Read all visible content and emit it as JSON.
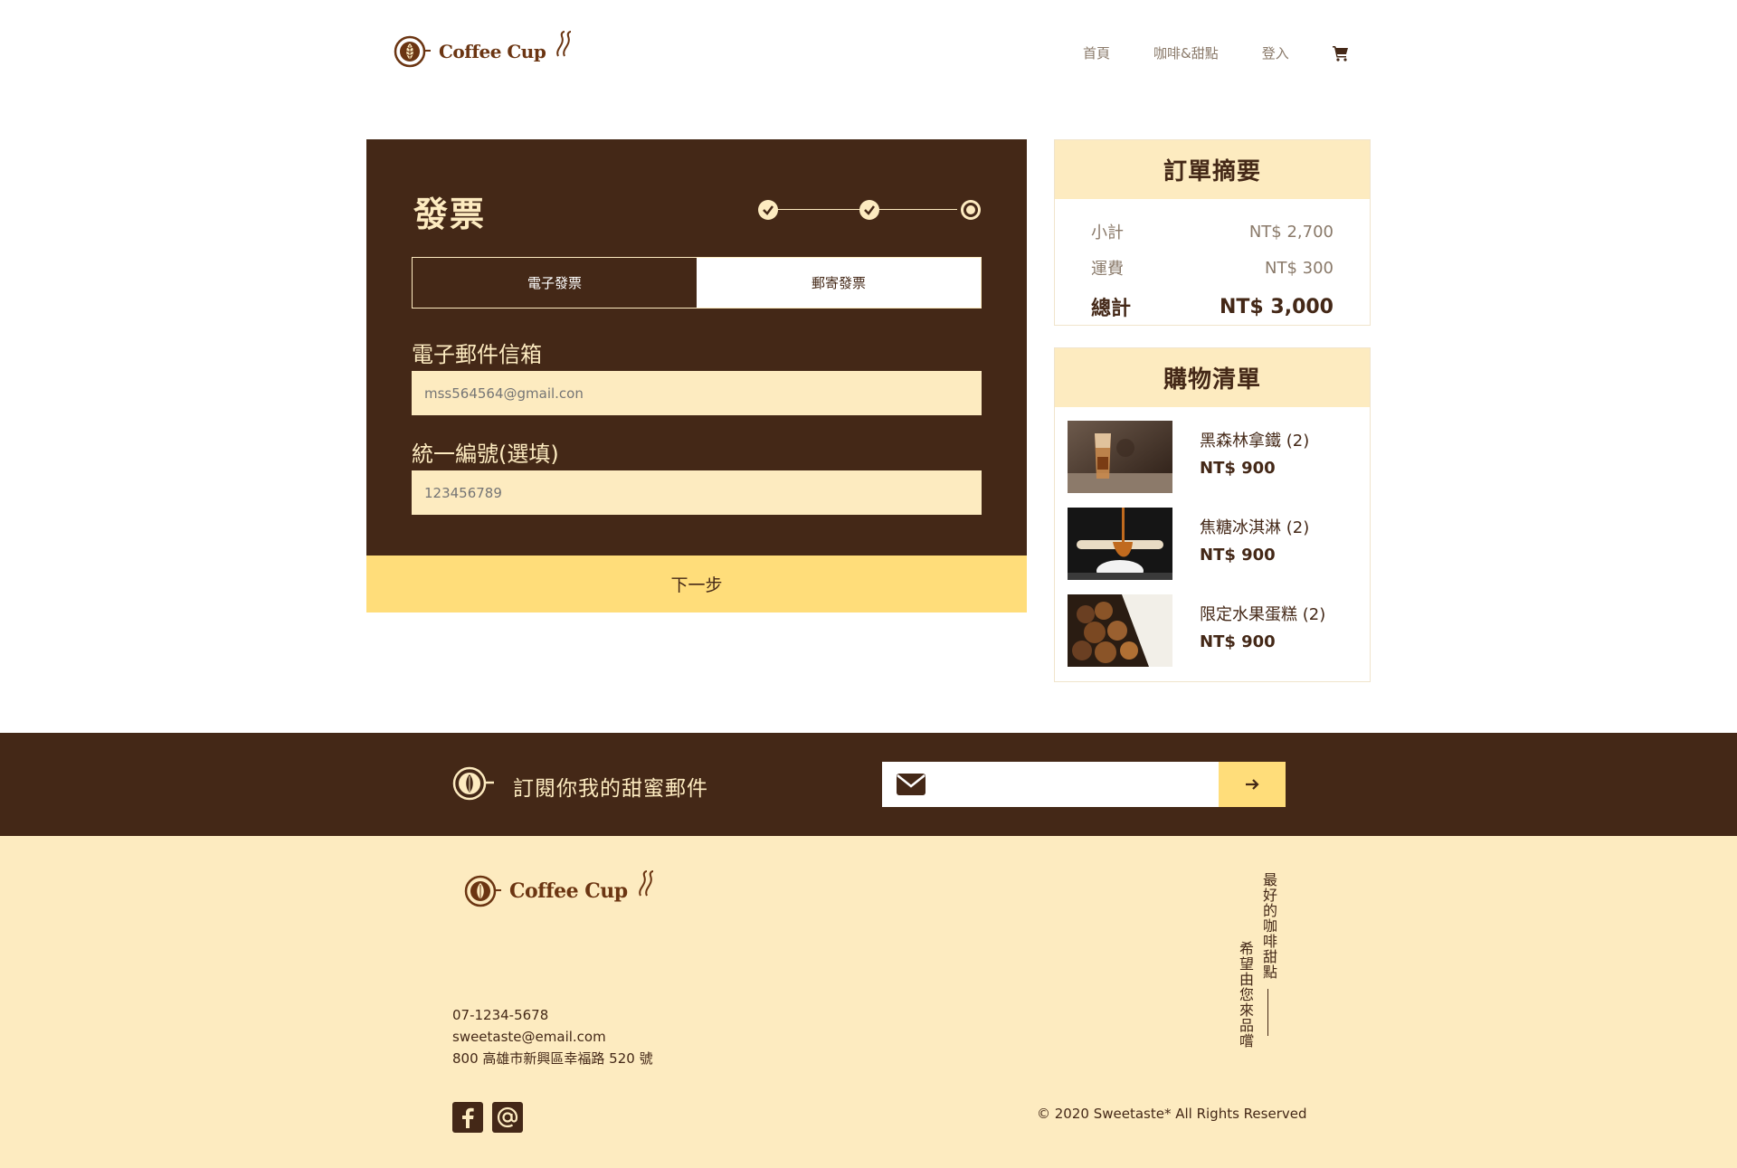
{
  "header": {
    "brand": "Coffee Cup",
    "nav": [
      {
        "label": "首頁"
      },
      {
        "label": "咖啡&甜點"
      },
      {
        "label": "登入"
      }
    ],
    "cart_icon": "cart-icon"
  },
  "invoice": {
    "title": "發票",
    "steps": {
      "total": 3,
      "completed": 2,
      "current": 3
    },
    "tabs": [
      {
        "label": "電子發票",
        "active": true
      },
      {
        "label": "郵寄發票",
        "active": false
      }
    ],
    "email_label": "電子郵件信箱",
    "email_placeholder": "mss564564@gmail.con",
    "tax_id_label": "統一編號(選填)",
    "tax_id_placeholder": "123456789",
    "next_label": "下一步"
  },
  "summary": {
    "title": "訂單摘要",
    "subtotal_label": "小計",
    "subtotal_value": "NT$ 2,700",
    "shipping_label": "運費",
    "shipping_value": "NT$ 300",
    "total_label": "總計",
    "total_value": "NT$ 3,000"
  },
  "cart": {
    "title": "購物清單",
    "items": [
      {
        "name": "黑森林拿鐵 (2)",
        "price": "NT$ 900"
      },
      {
        "name": "焦糖冰淇淋 (2)",
        "price": "NT$ 900"
      },
      {
        "name": "限定水果蛋糕 (2)",
        "price": "NT$ 900"
      }
    ]
  },
  "subscribe": {
    "text": "訂閱你我的甜蜜郵件",
    "input_placeholder": ""
  },
  "footer": {
    "brand": "Coffee Cup",
    "phone": "07-1234-5678",
    "email": "sweetaste@email.com",
    "address": "800 高雄市新興區幸福路 520 號",
    "copyright": "© 2020 Sweetaste* All Rights Reserved",
    "slogan_1": "最好的咖啡甜點",
    "slogan_2": "希望由您來品嚐"
  },
  "colors": {
    "dark_brown": "#442817",
    "cream": "#fdebc0",
    "yellow": "#ffdd7a",
    "brand_brown": "#6b3512"
  }
}
